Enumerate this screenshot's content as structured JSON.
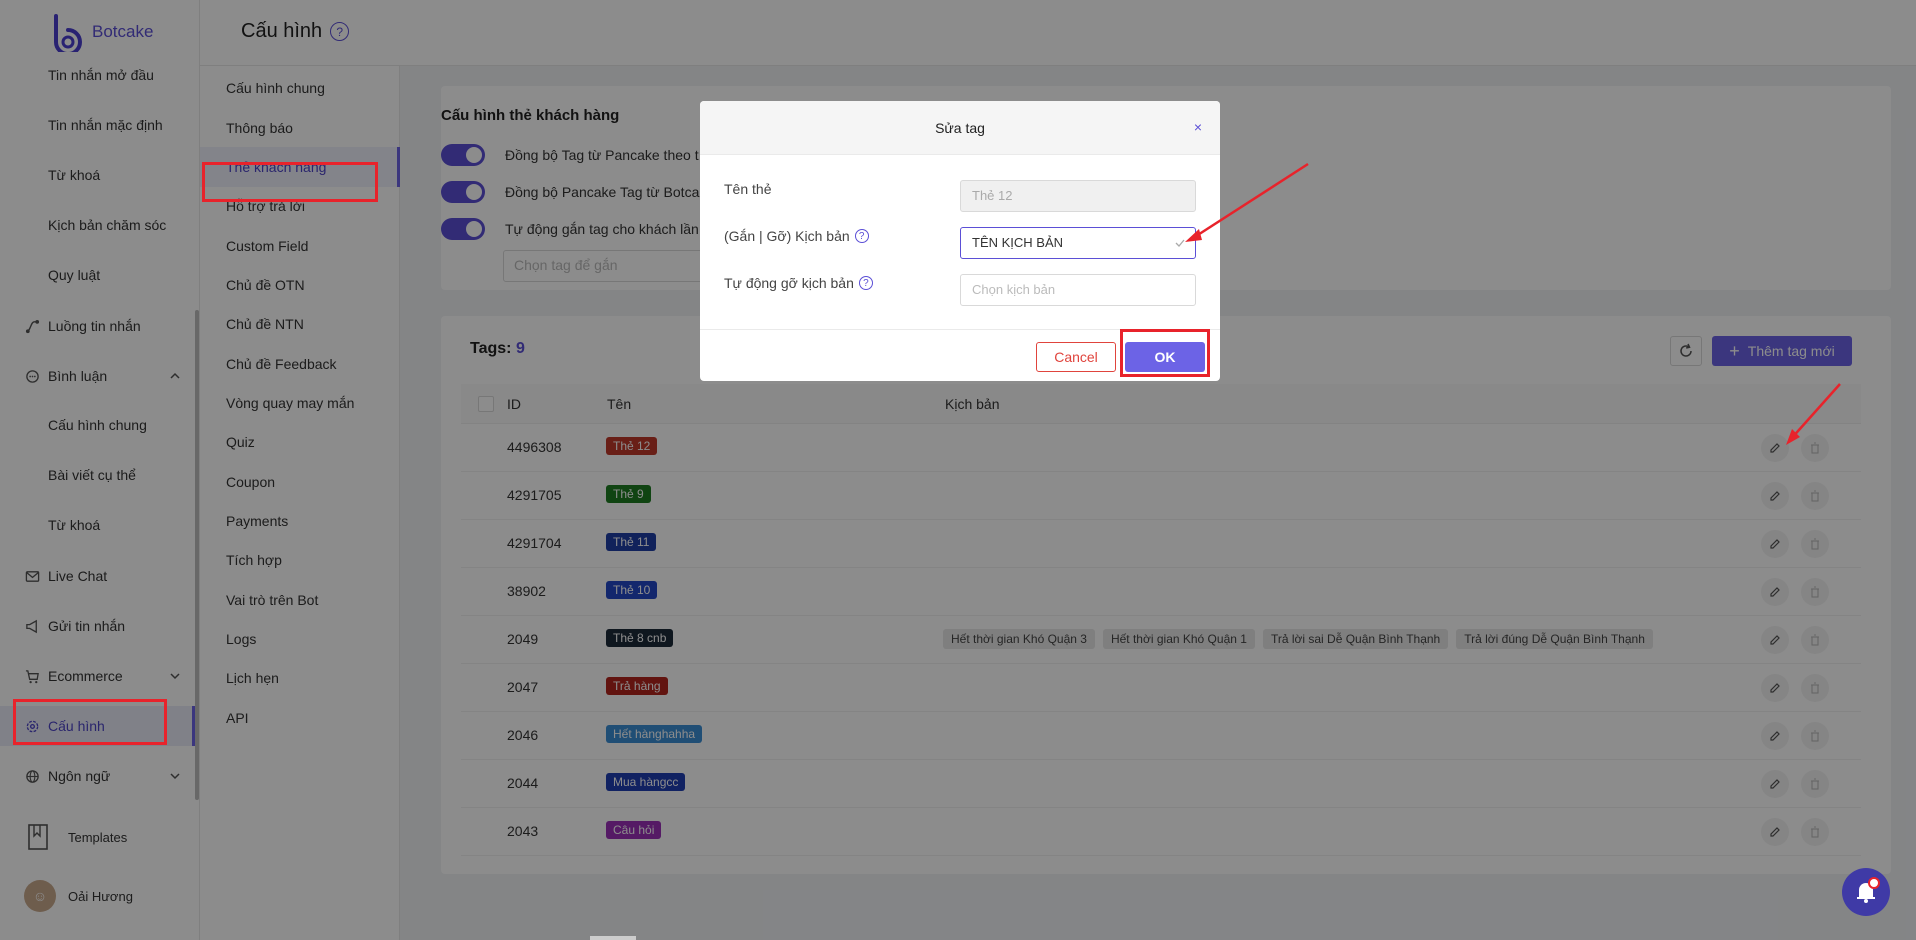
{
  "brand": {
    "name": "Botcake"
  },
  "header": {
    "title": "Cấu hình",
    "help": "?"
  },
  "sidebar": {
    "items": [
      {
        "label": "Tin nhắn mở đầu"
      },
      {
        "label": "Tin nhắn mặc định"
      },
      {
        "label": "Từ khoá"
      },
      {
        "label": "Kịch bản chăm sóc"
      },
      {
        "label": "Quy luật"
      },
      {
        "label": "Luồng tin nhắn"
      },
      {
        "label": "Bình luận"
      },
      {
        "label": "Cấu hình chung"
      },
      {
        "label": "Bài viết cụ thể"
      },
      {
        "label": "Từ khoá"
      },
      {
        "label": "Live Chat"
      },
      {
        "label": "Gửi tin nhắn"
      },
      {
        "label": "Ecommerce"
      },
      {
        "label": "Cấu hình"
      },
      {
        "label": "Ngôn ngữ"
      }
    ],
    "templates": "Templates",
    "user": "Oải Hương"
  },
  "subnav": {
    "items": [
      {
        "label": "Cấu hình chung"
      },
      {
        "label": "Thông báo"
      },
      {
        "label": "Thẻ khách hàng"
      },
      {
        "label": "Hỗ trợ trả lời"
      },
      {
        "label": "Custom Field"
      },
      {
        "label": "Chủ đề OTN"
      },
      {
        "label": "Chủ đề NTN"
      },
      {
        "label": "Chủ đề Feedback"
      },
      {
        "label": "Vòng quay may mắn"
      },
      {
        "label": "Quiz"
      },
      {
        "label": "Coupon"
      },
      {
        "label": "Payments"
      },
      {
        "label": "Tích hợp"
      },
      {
        "label": "Vai trò trên Bot"
      },
      {
        "label": "Logs"
      },
      {
        "label": "Lịch hẹn"
      },
      {
        "label": "API"
      }
    ]
  },
  "settings": {
    "title": "Cấu hình thẻ khách hàng",
    "toggles": [
      {
        "label": "Đồng bộ Tag từ Pancake theo t"
      },
      {
        "label": "Đồng bộ Pancake Tag từ Botcal"
      },
      {
        "label": "Tự động gắn tag cho khách lần"
      }
    ],
    "tag_select_placeholder": "Chọn tag để gắn"
  },
  "tags": {
    "label": "Tags:",
    "count": "9",
    "add_button": "Thêm tag mới",
    "columns": {
      "id": "ID",
      "name": "Tên",
      "script": "Kịch bản"
    },
    "rows": [
      {
        "id": "4496308",
        "name": "Thẻ 12",
        "color": "#c0392b",
        "scripts": []
      },
      {
        "id": "4291705",
        "name": "Thẻ 9",
        "color": "#1e7d22",
        "scripts": []
      },
      {
        "id": "4291704",
        "name": "Thẻ 11",
        "color": "#1f3fa6",
        "scripts": []
      },
      {
        "id": "38902",
        "name": "Thẻ 10",
        "color": "#2347c7",
        "scripts": []
      },
      {
        "id": "2049",
        "name": "Thẻ 8 cnb",
        "color": "#1c2a3a",
        "scripts": [
          "Hết thời gian Khó Quận 3",
          "Hết thời gian Khó Quận 1",
          "Trả lời sai Dễ Quận Bình Thạnh",
          "Trả lời đúng Dễ Quận Bình Thạnh"
        ]
      },
      {
        "id": "2047",
        "name": "Trả hàng",
        "color": "#b3261e",
        "scripts": []
      },
      {
        "id": "2046",
        "name": "Hết hànghahha",
        "color": "#3b8fd6",
        "scripts": []
      },
      {
        "id": "2044",
        "name": "Mua hàngcc",
        "color": "#1f3fb3",
        "scripts": []
      },
      {
        "id": "2043",
        "name": "Câu hỏi",
        "color": "#9b30b8",
        "scripts": []
      }
    ]
  },
  "modal": {
    "title": "Sửa tag",
    "close": "×",
    "fields": {
      "name_label": "Tên thẻ",
      "name_value": "Thẻ 12",
      "script_label": "(Gắn | Gỡ) Kịch bản",
      "script_value": "TÊN KỊCH BẢN",
      "auto_remove_label": "Tự động gỡ kịch bản",
      "auto_remove_placeholder": "Chọn kịch bản"
    },
    "cancel": "Cancel",
    "ok": "OK"
  }
}
